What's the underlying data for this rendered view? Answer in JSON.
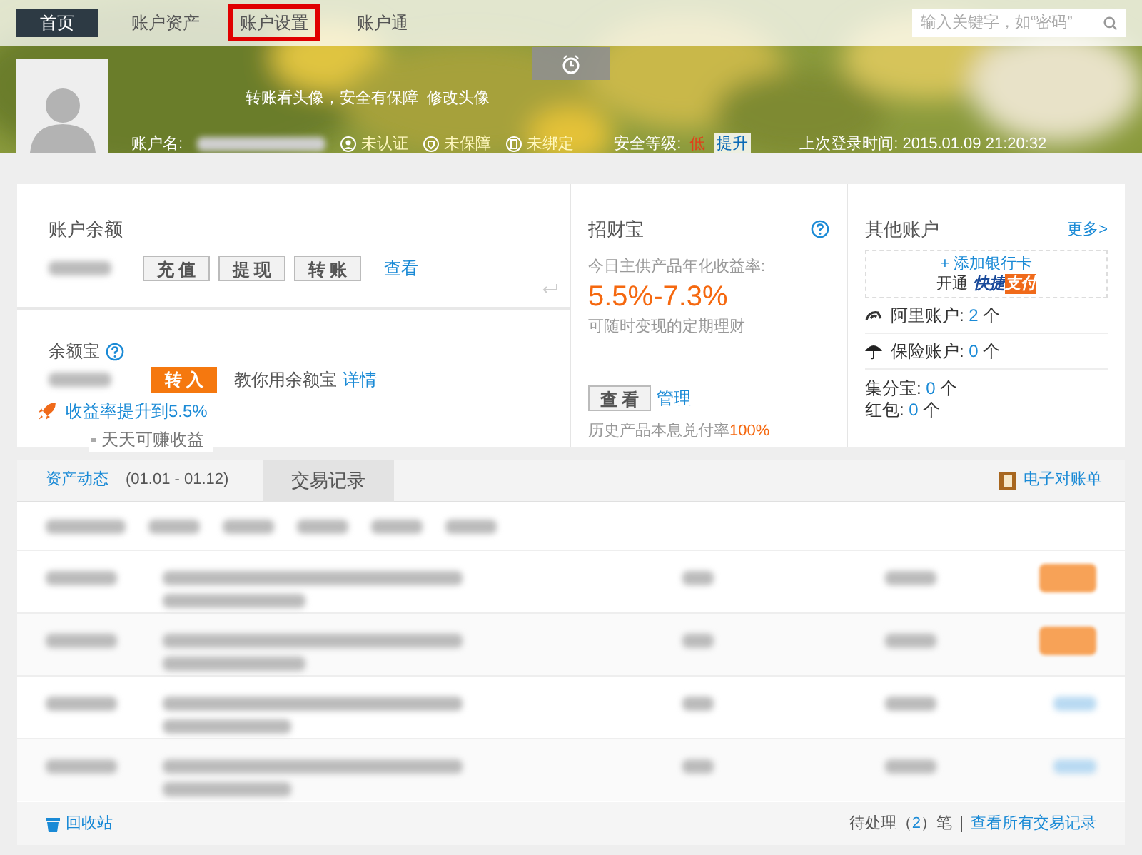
{
  "nav": {
    "tabs": [
      {
        "label": "首页",
        "selected": true,
        "highlighted": false
      },
      {
        "label": "账户资产",
        "selected": false,
        "highlighted": false
      },
      {
        "label": "账户设置",
        "selected": false,
        "highlighted": true
      },
      {
        "label": "账户通",
        "selected": false,
        "highlighted": false
      }
    ],
    "search": {
      "placeholder": "输入关键字，如“密码”"
    }
  },
  "profile": {
    "tagline": "转账看头像，安全有保障",
    "change_avatar": "修改头像",
    "account_label": "账户名:",
    "statuses": [
      {
        "label": "未认证",
        "kind": "person"
      },
      {
        "label": "未保障",
        "kind": "shield"
      },
      {
        "label": "未绑定",
        "kind": "phone"
      }
    ],
    "security_label": "安全等级:",
    "security_level": "低",
    "upgrade": "提升",
    "last_login": "上次登录时间: 2015.01.09 21:20:32"
  },
  "balance": {
    "title": "账户余额",
    "buttons": [
      "充 值",
      "提 现",
      "转 账"
    ],
    "link": "查看"
  },
  "yuebao": {
    "title": "余额宝",
    "button": "转 入",
    "hint": "教你用余额宝",
    "hint_link": "详情",
    "promo": "收益率提升到5.5%",
    "tip": "天天可赚收益"
  },
  "zhaocaibao": {
    "title": "招财宝",
    "rate_label": "今日主供产品年化收益率:",
    "rate": "5.5%-7.3%",
    "desc": "可随时变现的定期理财",
    "button": "查 看",
    "manage": "管理",
    "history": "历史产品本息兑付率",
    "history_rate": "100%"
  },
  "other_accounts": {
    "title": "其他账户",
    "more": "更多>",
    "add_card": "+ 添加银行卡",
    "open": "开通",
    "quickpay_a": "快捷",
    "quickpay_b": "支付",
    "items": [
      {
        "kind": "ali",
        "label": "阿里账户:",
        "count": "2",
        "unit": "个"
      },
      {
        "kind": "umbrella",
        "label": "保险账户:",
        "count": "0",
        "unit": "个"
      },
      {
        "kind": "plain",
        "label": "集分宝:",
        "count": "0",
        "unit": "个"
      },
      {
        "kind": "plain",
        "label": "红包:",
        "count": "0",
        "unit": "个"
      }
    ]
  },
  "records": {
    "tabs": [
      {
        "label": "资产动态",
        "selected": false
      },
      {
        "label": "交易记录",
        "selected": true
      }
    ],
    "range": "(01.01 - 01.12)",
    "statement": "电子对账单",
    "rows": [
      {
        "kind": "pending"
      },
      {
        "kind": "pending"
      },
      {
        "kind": "done"
      },
      {
        "kind": "done"
      }
    ],
    "recycle": "回收站",
    "pending_a": "待处理（",
    "pending_count": "2",
    "pending_b": "）笔",
    "all_link": "查看所有交易记录"
  }
}
